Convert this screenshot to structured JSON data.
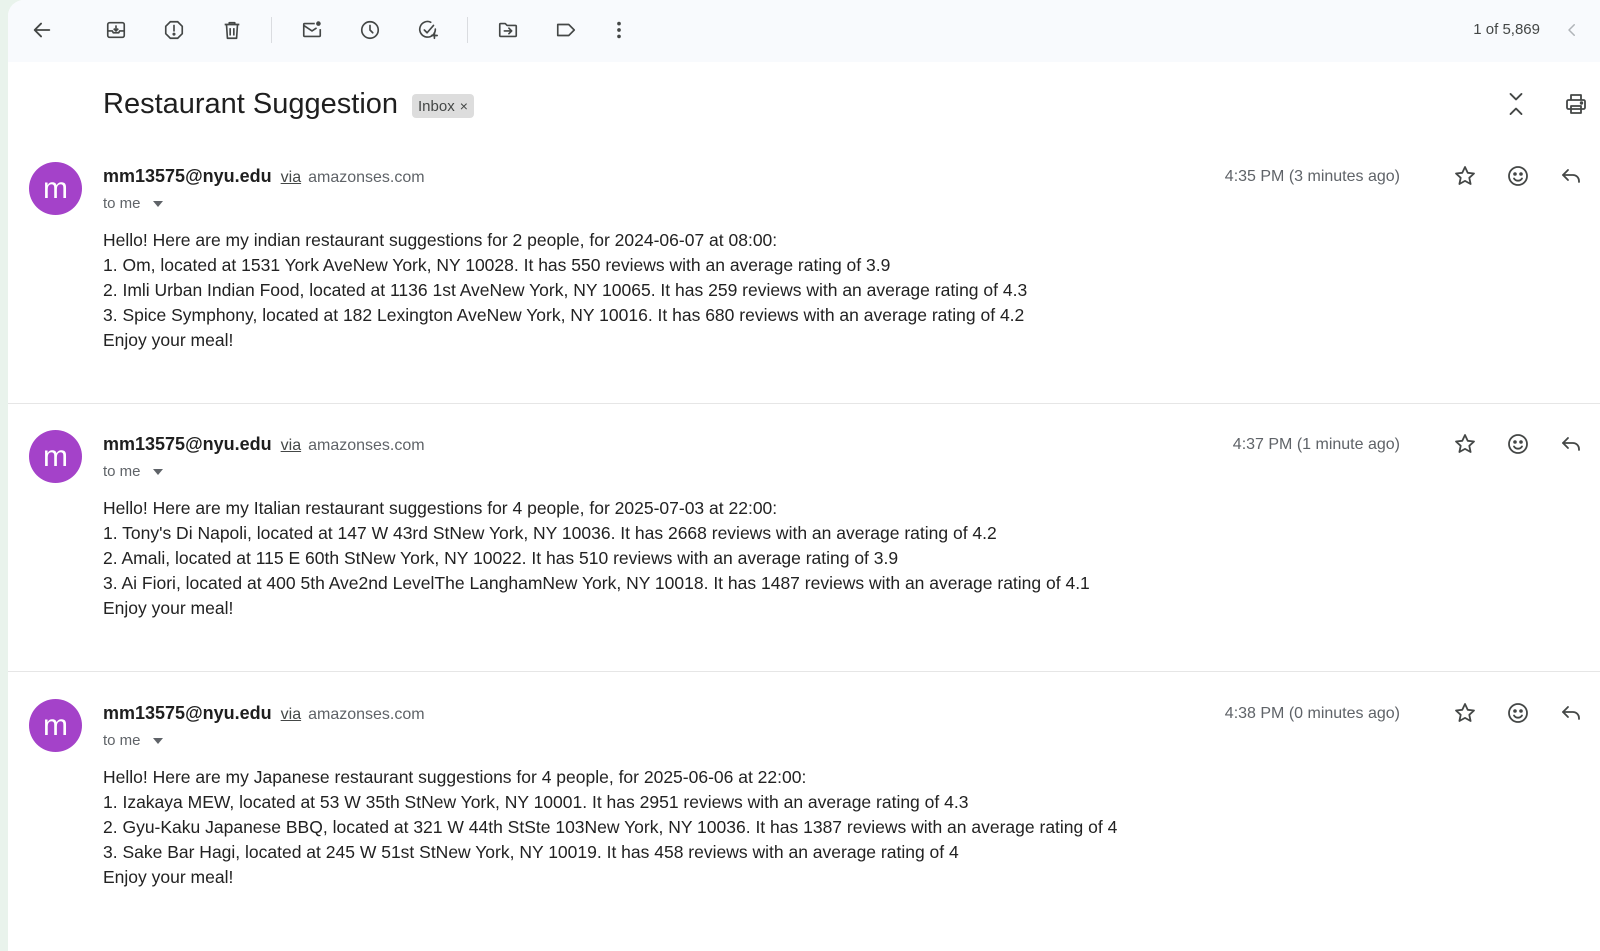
{
  "toolbar": {
    "icons": [
      "back-arrow-icon",
      "archive-icon",
      "report-spam-icon",
      "delete-icon",
      "mark-unread-icon",
      "snooze-icon",
      "add-to-tasks-icon",
      "move-to-icon",
      "label-icon",
      "more-vert-icon"
    ],
    "pager_text": "1 of 5,869"
  },
  "thread": {
    "subject": "Restaurant Suggestion",
    "label_chip": "Inbox",
    "label_close": "×"
  },
  "messages": [
    {
      "avatar_letter": "m",
      "sender": "mm13575@nyu.edu",
      "via_label": "via",
      "via_domain": "amazonses.com",
      "to": "to me",
      "time": "4:35 PM (3 minutes ago)",
      "body": [
        "Hello! Here are my indian restaurant suggestions for 2 people, for 2024-06-07 at 08:00:",
        "1. Om, located at 1531 York AveNew York, NY 10028. It has 550 reviews with an average rating of 3.9",
        "2. Imli Urban Indian Food, located at 1136 1st AveNew York, NY 10065. It has 259 reviews with an average rating of 4.3",
        "3. Spice Symphony, located at 182 Lexington AveNew York, NY 10016. It has 680 reviews with an average rating of 4.2",
        "Enjoy your meal!"
      ]
    },
    {
      "avatar_letter": "m",
      "sender": "mm13575@nyu.edu",
      "via_label": "via",
      "via_domain": "amazonses.com",
      "to": "to me",
      "time": "4:37 PM (1 minute ago)",
      "body": [
        "Hello! Here are my Italian restaurant suggestions for 4 people, for 2025-07-03 at 22:00:",
        "1. Tony's Di Napoli, located at 147 W 43rd StNew York, NY 10036. It has 2668 reviews with an average rating of 4.2",
        "2. Amali, located at 115 E 60th StNew York, NY 10022. It has 510 reviews with an average rating of 3.9",
        "3. Ai Fiori, located at 400 5th Ave2nd LevelThe LanghamNew York, NY 10018. It has 1487 reviews with an average rating of 4.1",
        "Enjoy your meal!"
      ]
    },
    {
      "avatar_letter": "m",
      "sender": "mm13575@nyu.edu",
      "via_label": "via",
      "via_domain": "amazonses.com",
      "to": "to me",
      "time": "4:38 PM (0 minutes ago)",
      "body": [
        "Hello! Here are my Japanese restaurant suggestions for 4 people, for 2025-06-06 at 22:00:",
        "1. Izakaya MEW, located at 53 W 35th StNew York, NY 10001. It has 2951 reviews with an average rating of 4.3",
        "2. Gyu-Kaku Japanese BBQ, located at 321 W 44th StSte 103New York, NY 10036. It has 1387 reviews with an average rating of 4",
        "3. Sake Bar Hagi, located at 245 W 51st StNew York, NY 10019. It has 458 reviews with an average rating of 4",
        "Enjoy your meal!"
      ]
    }
  ],
  "colors": {
    "avatar": "#a442c9",
    "toolbar_bg": "#f8fafd",
    "page_bg": "#e9f3ec"
  }
}
